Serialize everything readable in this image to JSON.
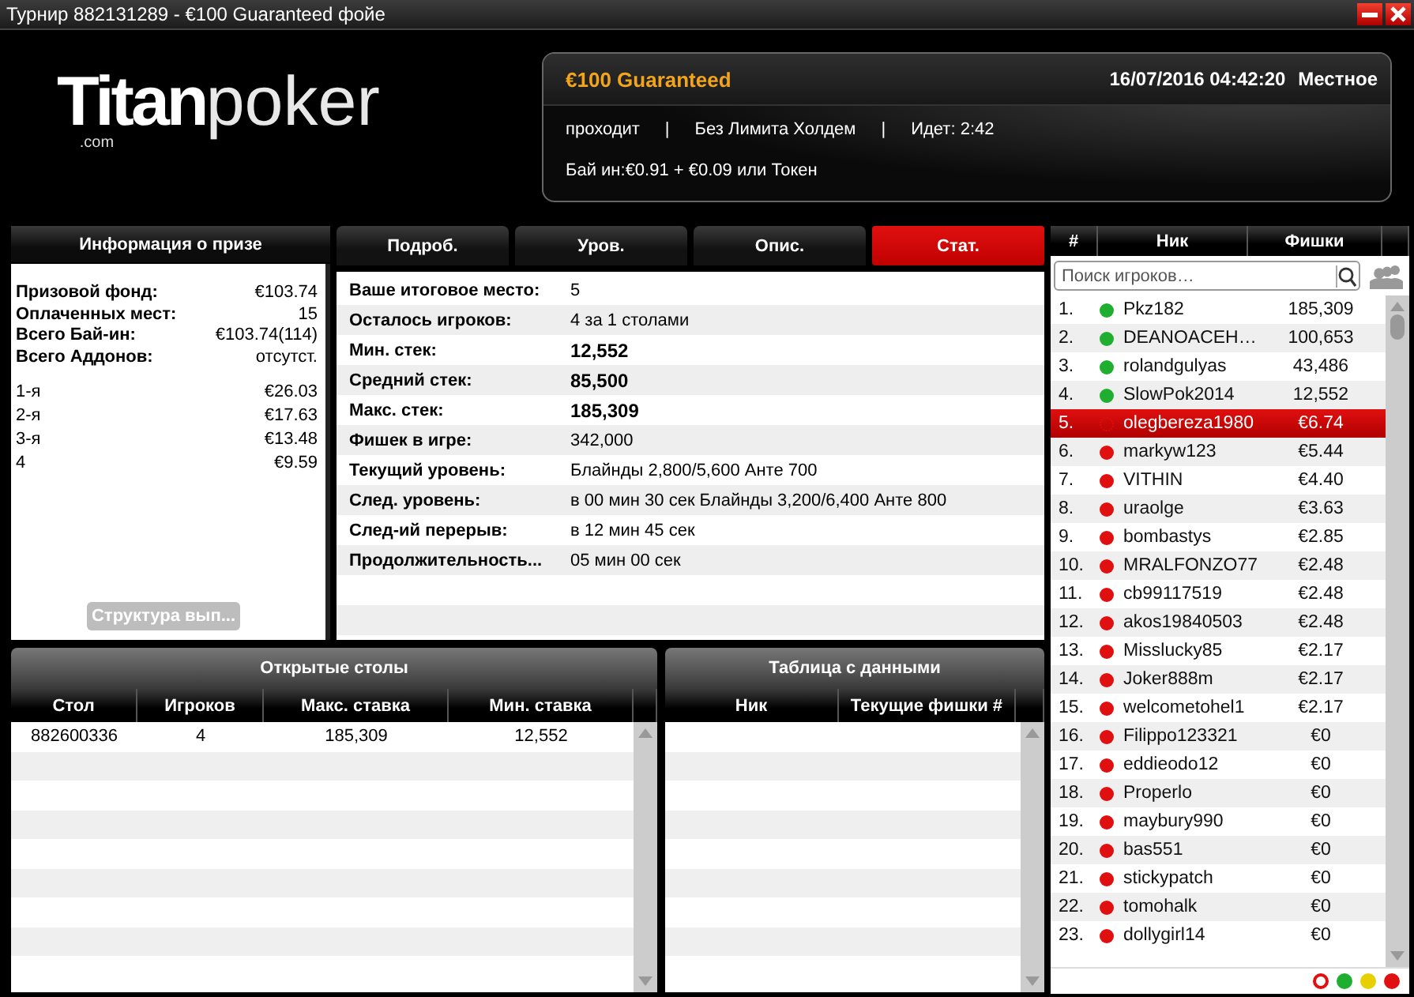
{
  "window": {
    "title": "Турнир 882131289 - €100 Guaranteed фойе",
    "controls": [
      {
        "kind": "minimize"
      },
      {
        "kind": "close"
      }
    ]
  },
  "logo": {
    "primary": "Titan",
    "secondary": "poker",
    "suffix": ".com"
  },
  "tournament": {
    "name": "€100 Guaranteed",
    "datetime": "16/07/2016 04:42:20",
    "timezone": "Местное",
    "details": [
      "проходит",
      "|",
      "Без Лимита Холдем",
      "|",
      "Идет: 2:42"
    ],
    "buy_in": "Бай ин:€0.91 + €0.09 или Токен"
  },
  "prize_info": {
    "title": "Информация о призе",
    "summary": [
      {
        "label": "Призовой фонд:",
        "value": "€103.74"
      },
      {
        "label": "Оплаченных мест:",
        "value": "15"
      },
      {
        "label": "Всего Бай-ин:",
        "value": "€103.74(114)"
      },
      {
        "label": "Всего Аддонов:",
        "value": "отсутст."
      }
    ],
    "places": [
      {
        "place": "1-я",
        "prize": "€26.03"
      },
      {
        "place": "2-я",
        "prize": "€17.63"
      },
      {
        "place": "3-я",
        "prize": "€13.48"
      },
      {
        "place": "4",
        "prize": "€9.59"
      }
    ],
    "button": {
      "label": "Структура вып...",
      "disabled": true
    }
  },
  "tabs": [
    {
      "label": "Подроб.",
      "selected": false
    },
    {
      "label": "Уров.",
      "selected": false
    },
    {
      "label": "Опис.",
      "selected": false
    },
    {
      "label": "Стат.",
      "selected": true
    }
  ],
  "stats": [
    {
      "label": "Ваше итоговое место:",
      "value": "5",
      "bold": false
    },
    {
      "label": "Осталось игроков:",
      "value": "4 за 1 столами",
      "bold": false
    },
    {
      "label": "Мин. стек:",
      "value": "12,552",
      "bold": true
    },
    {
      "label": "Средний стек:",
      "value": "85,500",
      "bold": true
    },
    {
      "label": "Макс. стек:",
      "value": "185,309",
      "bold": true
    },
    {
      "label": "Фишек в игре:",
      "value": "342,000",
      "bold": false
    },
    {
      "label": "Текущий уровень:",
      "value": "Блайнды 2,800/5,600 Анте 700",
      "bold": false
    },
    {
      "label": "След. уровень:",
      "value": "в 00 мин 30 сек  Блайнды 3,200/6,400 Анте 800",
      "bold": false
    },
    {
      "label": "След-ий перерыв:",
      "value": "в 12 мин 45 сек",
      "bold": false
    },
    {
      "label": "Продолжительность...",
      "value": "05 мин 00 сек",
      "bold": false
    }
  ],
  "open_tables": {
    "title": "Открытые столы",
    "columns": [
      "Стол",
      "Игроков",
      "Макс. ставка",
      "Мин. ставка"
    ],
    "rows": [
      [
        "882600336",
        "4",
        "185,309",
        "12,552"
      ]
    ]
  },
  "data_table": {
    "title": "Таблица с данными",
    "columns": [
      "Ник",
      "Текущие фишки #"
    ]
  },
  "players": {
    "columns": [
      "#",
      "Ник",
      "Фишки"
    ],
    "search": {
      "placeholder": "Поиск игроков…"
    },
    "rows": [
      {
        "rank": "1.",
        "name": "Pkz182",
        "chips": "185,309",
        "color": "#1fae2f",
        "selected": false
      },
      {
        "rank": "2.",
        "name": "DEANOACEH…",
        "chips": "100,653",
        "color": "#1fae2f",
        "selected": false
      },
      {
        "rank": "3.",
        "name": "rolandgulyas",
        "chips": "43,486",
        "color": "#1fae2f",
        "selected": false
      },
      {
        "rank": "4.",
        "name": "SlowPok2014",
        "chips": "12,552",
        "color": "#1fae2f",
        "selected": false
      },
      {
        "rank": "5.",
        "name": "olegbereza1980",
        "chips": "€6.74",
        "color": "#e01010",
        "selected": true
      },
      {
        "rank": "6.",
        "name": "markyw123",
        "chips": "€5.44",
        "color": "#e01010",
        "selected": false
      },
      {
        "rank": "7.",
        "name": "VITHIN",
        "chips": "€4.40",
        "color": "#e01010",
        "selected": false
      },
      {
        "rank": "8.",
        "name": "uraolge",
        "chips": "€3.63",
        "color": "#e01010",
        "selected": false
      },
      {
        "rank": "9.",
        "name": "bombastys",
        "chips": "€2.85",
        "color": "#e01010",
        "selected": false
      },
      {
        "rank": "10.",
        "name": "MRALFONZO77",
        "chips": "€2.48",
        "color": "#e01010",
        "selected": false
      },
      {
        "rank": "11.",
        "name": "cb99117519",
        "chips": "€2.48",
        "color": "#e01010",
        "selected": false
      },
      {
        "rank": "12.",
        "name": "akos19840503",
        "chips": "€2.48",
        "color": "#e01010",
        "selected": false
      },
      {
        "rank": "13.",
        "name": "Misslucky85",
        "chips": "€2.17",
        "color": "#e01010",
        "selected": false
      },
      {
        "rank": "14.",
        "name": "Joker888m",
        "chips": "€2.17",
        "color": "#e01010",
        "selected": false
      },
      {
        "rank": "15.",
        "name": "welcometohel1",
        "chips": "€2.17",
        "color": "#e01010",
        "selected": false
      },
      {
        "rank": "16.",
        "name": "Filippo123321",
        "chips": "€0",
        "color": "#e01010",
        "selected": false
      },
      {
        "rank": "17.",
        "name": "eddieodo12",
        "chips": "€0",
        "color": "#e01010",
        "selected": false
      },
      {
        "rank": "18.",
        "name": "Properlo",
        "chips": "€0",
        "color": "#e01010",
        "selected": false
      },
      {
        "rank": "19.",
        "name": "maybury990",
        "chips": "€0",
        "color": "#e01010",
        "selected": false
      },
      {
        "rank": "20.",
        "name": "bas551",
        "chips": "€0",
        "color": "#e01010",
        "selected": false
      },
      {
        "rank": "21.",
        "name": "stickypatch",
        "chips": "€0",
        "color": "#e01010",
        "selected": false
      },
      {
        "rank": "22.",
        "name": "tomohalk",
        "chips": "€0",
        "color": "#e01010",
        "selected": false
      },
      {
        "rank": "23.",
        "name": "dollygirl14",
        "chips": "€0",
        "color": "#e01010",
        "selected": false
      }
    ],
    "legend": [
      {
        "kind": "ring",
        "color": "#e01010"
      },
      {
        "kind": "dot",
        "color": "#1fae2f"
      },
      {
        "kind": "dot",
        "color": "#e8d000"
      },
      {
        "kind": "dot",
        "color": "#e01010"
      }
    ]
  }
}
